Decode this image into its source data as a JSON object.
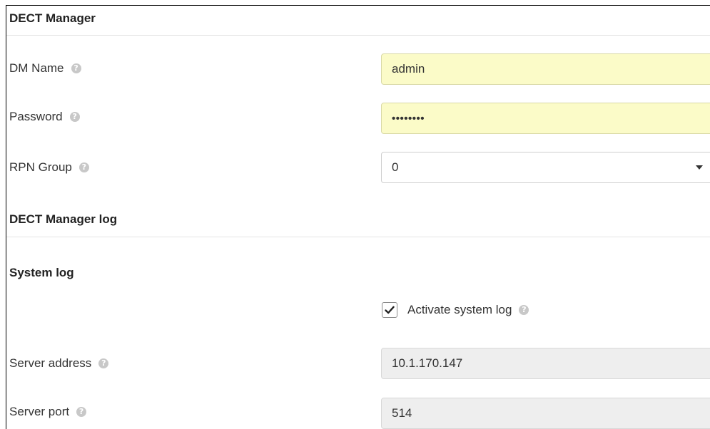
{
  "sections": {
    "dect_manager": "DECT Manager",
    "dect_manager_log": "DECT Manager log",
    "system_log": "System log"
  },
  "fields": {
    "dm_name": {
      "label": "DM Name",
      "value": "admin"
    },
    "password": {
      "label": "Password",
      "value": "••••••••"
    },
    "rpn_group": {
      "label": "RPN Group",
      "value": "0"
    },
    "activate_system_log": {
      "label": "Activate system log",
      "checked": true
    },
    "server_address": {
      "label": "Server address",
      "value": "10.1.170.147"
    },
    "server_port": {
      "label": "Server port",
      "value": "514"
    }
  },
  "icons": {
    "help": "?"
  },
  "colors": {
    "highlight_field": "#fbfbc8",
    "disabled_field": "#eeeeee",
    "help_icon": "#c8c8c8"
  }
}
